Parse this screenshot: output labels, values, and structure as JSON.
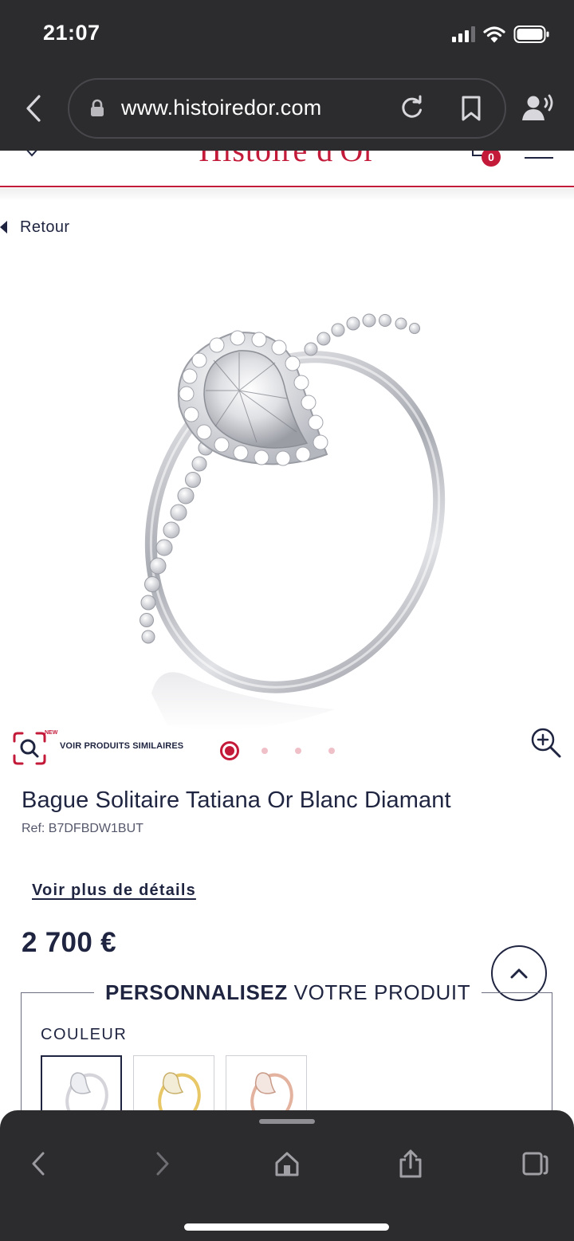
{
  "status_bar": {
    "time": "21:07"
  },
  "browser": {
    "url": "www.histoiredor.com"
  },
  "site_header": {
    "logo_text": "Histoire d'Or",
    "cart_count": "0",
    "brand_color": "#c41a3a"
  },
  "navigation": {
    "back_label": "Retour"
  },
  "gallery": {
    "new_badge": "NEW",
    "similar_label": "VOIR PRODUITS SIMILAIRES",
    "slide_count": 4,
    "active_slide": 1
  },
  "product": {
    "title": "Bague Solitaire Tatiana Or Blanc Diamant",
    "ref": "Ref: B7DFBDW1BUT",
    "details_link": "Voir plus de détails",
    "price": "2 700 €"
  },
  "customize": {
    "heading_bold": "PERSONNALISEZ",
    "heading_rest": " VOTRE PRODUIT",
    "color_label": "COULEUR",
    "swatches": [
      {
        "name": "white-gold",
        "color": "#d9d9de",
        "selected": true
      },
      {
        "name": "yellow-gold",
        "color": "#e8c766",
        "selected": false
      },
      {
        "name": "rose-gold",
        "color": "#e4b3a0",
        "selected": false
      }
    ]
  },
  "icons": [
    "lock-icon",
    "reload-icon",
    "bookmark-icon",
    "voice-icon",
    "search-icon",
    "zoom-icon",
    "chevron-up-icon",
    "share-icon",
    "home-icon",
    "tabs-icon"
  ]
}
